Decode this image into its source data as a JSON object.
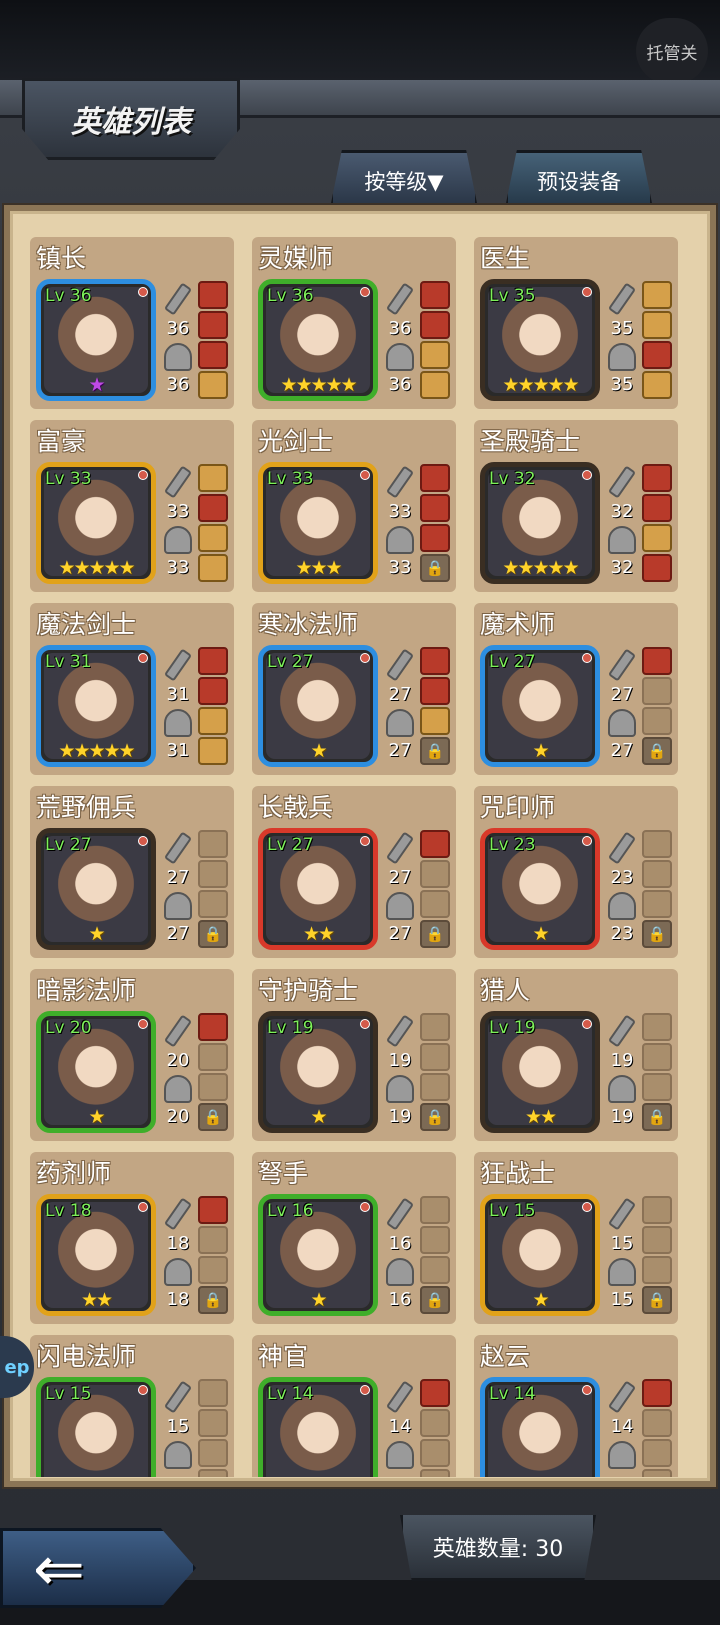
{
  "header": {
    "title": "英雄列表",
    "auto_label": "托管关"
  },
  "tabs": {
    "sort_label": "按等级▼",
    "preset_label": "预设装备"
  },
  "footer": {
    "count_text": "英雄数量: 30",
    "back_arrow": "⇐",
    "side_tag": "ep"
  },
  "heroes": [
    {
      "name": "镇长",
      "level": "Lv 36",
      "atk": "36",
      "def": "36",
      "stars": "★",
      "frame": "blue",
      "star_color": "purple",
      "slots": [
        "filled",
        "filled",
        "filled",
        "filled2"
      ]
    },
    {
      "name": "灵媒师",
      "level": "Lv 36",
      "atk": "36",
      "def": "36",
      "stars": "★★★★★",
      "frame": "green",
      "star_color": "gold",
      "slots": [
        "filled",
        "filled",
        "filled2",
        "filled2"
      ]
    },
    {
      "name": "医生",
      "level": "Lv 35",
      "atk": "35",
      "def": "35",
      "stars": "★★★★★",
      "frame": "dark",
      "star_color": "gold",
      "slots": [
        "filled2",
        "filled2",
        "filled",
        "filled2"
      ]
    },
    {
      "name": "富豪",
      "level": "Lv 33",
      "atk": "33",
      "def": "33",
      "stars": "★★★★★",
      "frame": "gold",
      "star_color": "gold",
      "slots": [
        "filled2",
        "filled",
        "filled2",
        "filled2"
      ]
    },
    {
      "name": "光剑士",
      "level": "Lv 33",
      "atk": "33",
      "def": "33",
      "stars": "★★★",
      "frame": "gold",
      "star_color": "gold",
      "slots": [
        "filled",
        "filled",
        "filled",
        "lock"
      ]
    },
    {
      "name": "圣殿骑士",
      "level": "Lv 32",
      "atk": "32",
      "def": "32",
      "stars": "★★★★★",
      "frame": "dark",
      "star_color": "gold",
      "slots": [
        "filled",
        "filled",
        "filled2",
        "filled"
      ]
    },
    {
      "name": "魔法剑士",
      "level": "Lv 31",
      "atk": "31",
      "def": "31",
      "stars": "★★★★★",
      "frame": "blue",
      "star_color": "gold",
      "slots": [
        "filled",
        "filled",
        "filled2",
        "filled2"
      ]
    },
    {
      "name": "寒冰法师",
      "level": "Lv 27",
      "atk": "27",
      "def": "27",
      "stars": "★",
      "frame": "blue",
      "star_color": "gold",
      "slots": [
        "filled",
        "filled",
        "filled2",
        "lock"
      ]
    },
    {
      "name": "魔术师",
      "level": "Lv 27",
      "atk": "27",
      "def": "27",
      "stars": "★",
      "frame": "blue",
      "star_color": "gold",
      "slots": [
        "filled",
        "empty",
        "empty",
        "lock"
      ]
    },
    {
      "name": "荒野佣兵",
      "level": "Lv 27",
      "atk": "27",
      "def": "27",
      "stars": "★",
      "frame": "dark",
      "star_color": "gold",
      "slots": [
        "empty",
        "empty",
        "empty",
        "lock"
      ]
    },
    {
      "name": "长戟兵",
      "level": "Lv 27",
      "atk": "27",
      "def": "27",
      "stars": "★★",
      "frame": "red",
      "star_color": "gold",
      "slots": [
        "filled",
        "empty",
        "empty",
        "lock"
      ]
    },
    {
      "name": "咒印师",
      "level": "Lv 23",
      "atk": "23",
      "def": "23",
      "stars": "★",
      "frame": "red",
      "star_color": "gold",
      "slots": [
        "empty",
        "empty",
        "empty",
        "lock"
      ]
    },
    {
      "name": "暗影法师",
      "level": "Lv 20",
      "atk": "20",
      "def": "20",
      "stars": "★",
      "frame": "green",
      "star_color": "gold",
      "slots": [
        "filled",
        "empty",
        "empty",
        "lock"
      ]
    },
    {
      "name": "守护骑士",
      "level": "Lv 19",
      "atk": "19",
      "def": "19",
      "stars": "★",
      "frame": "dark",
      "star_color": "gold",
      "slots": [
        "empty",
        "empty",
        "empty",
        "lock"
      ]
    },
    {
      "name": "猎人",
      "level": "Lv 19",
      "atk": "19",
      "def": "19",
      "stars": "★★",
      "frame": "dark",
      "star_color": "gold",
      "slots": [
        "empty",
        "empty",
        "empty",
        "lock"
      ]
    },
    {
      "name": "药剂师",
      "level": "Lv 18",
      "atk": "18",
      "def": "18",
      "stars": "★★",
      "frame": "gold",
      "star_color": "gold",
      "slots": [
        "filled",
        "empty",
        "empty",
        "lock"
      ]
    },
    {
      "name": "弩手",
      "level": "Lv 16",
      "atk": "16",
      "def": "16",
      "stars": "★",
      "frame": "green",
      "star_color": "gold",
      "slots": [
        "empty",
        "empty",
        "empty",
        "lock"
      ]
    },
    {
      "name": "狂战士",
      "level": "Lv 15",
      "atk": "15",
      "def": "15",
      "stars": "★",
      "frame": "gold",
      "star_color": "gold",
      "slots": [
        "empty",
        "empty",
        "empty",
        "lock"
      ]
    },
    {
      "name": "闪电法师",
      "level": "Lv 15",
      "atk": "15",
      "def": "",
      "stars": "",
      "frame": "green",
      "star_color": "gold",
      "slots": [
        "empty",
        "empty",
        "empty",
        "empty"
      ]
    },
    {
      "name": "神官",
      "level": "Lv 14",
      "atk": "14",
      "def": "",
      "stars": "",
      "frame": "green",
      "star_color": "gold",
      "slots": [
        "filled",
        "empty",
        "empty",
        "empty"
      ]
    },
    {
      "name": "赵云",
      "level": "Lv 14",
      "atk": "14",
      "def": "",
      "stars": "",
      "frame": "blue",
      "star_color": "gold",
      "slots": [
        "filled",
        "empty",
        "empty",
        "empty"
      ]
    }
  ]
}
